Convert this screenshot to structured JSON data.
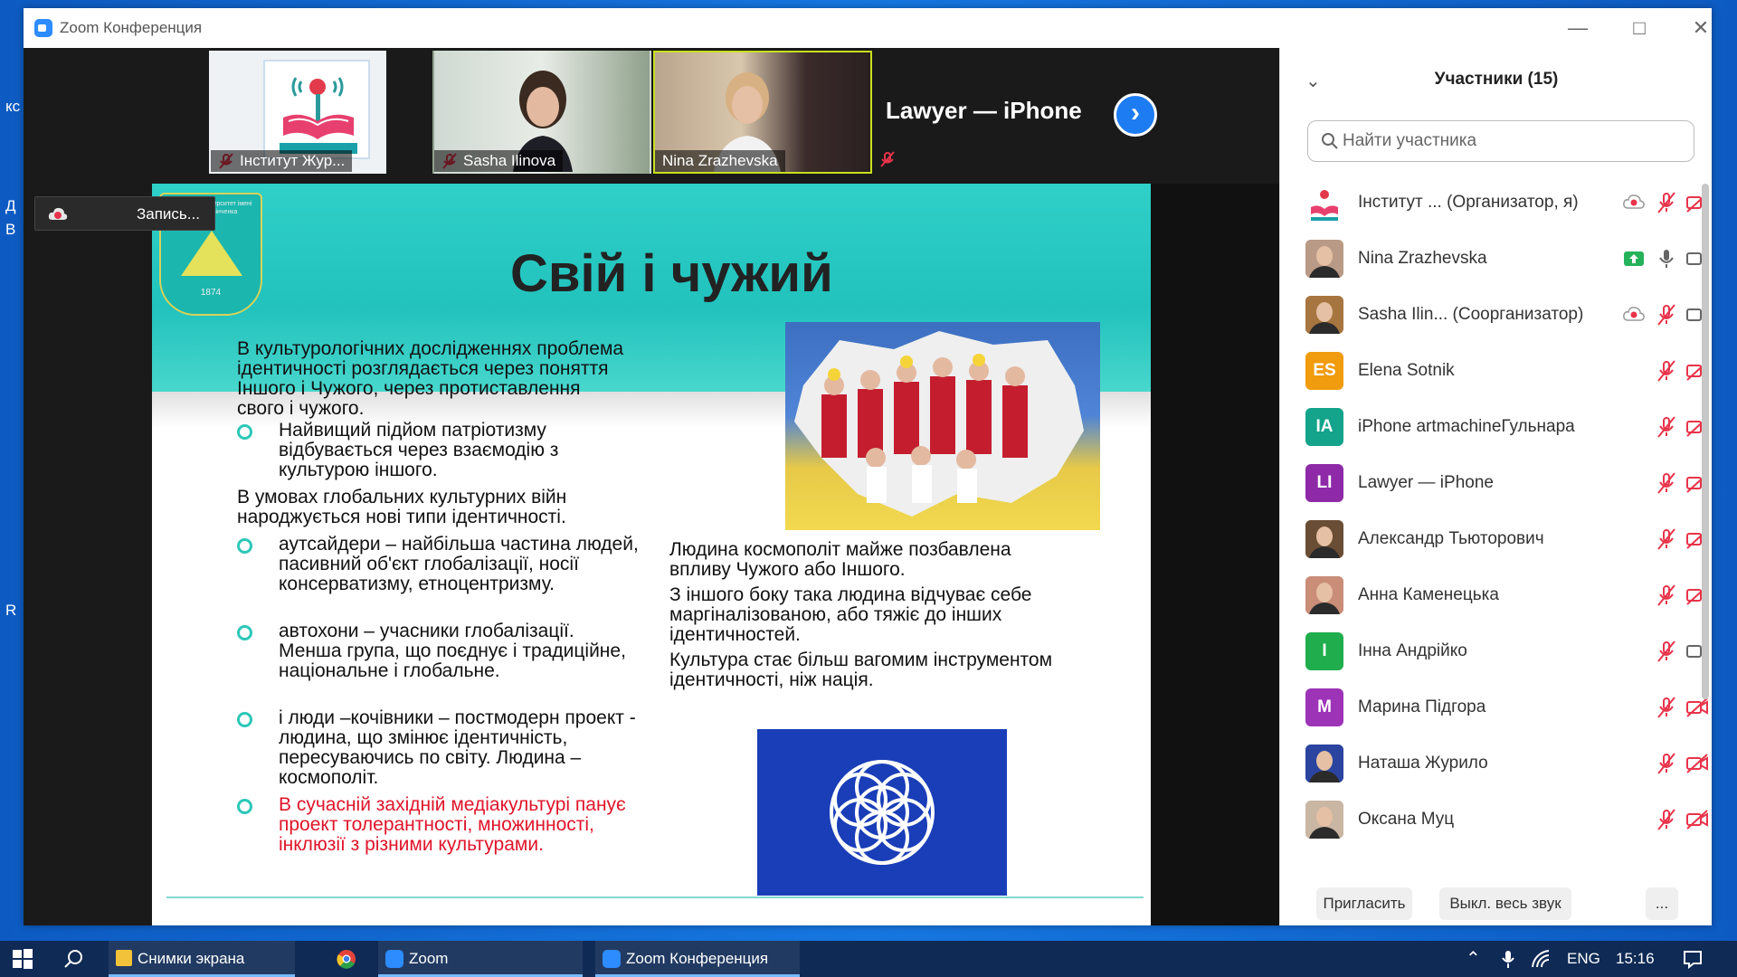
{
  "window": {
    "title": "Zoom Конференция"
  },
  "desktop_labels": [
    "кс",
    "Д",
    "В",
    "R"
  ],
  "thumbnails": [
    {
      "name": "Інститут Жур..."
    },
    {
      "name": "Sasha Ilinova"
    },
    {
      "name": "Nina Zrazhevska"
    }
  ],
  "big_name": "Lawyer — iPhone",
  "recording": {
    "label": "Запись..."
  },
  "slide": {
    "title": "Свій і чужий",
    "logo_caption": "Київський університет імені Бориса Грінченка",
    "logo_year": "1874",
    "intro": "В культурологічних дослідженнях проблема ідентичності розглядається через поняття Іншого і Чужого, через протиставлення свого і чужого.",
    "bullet1": "Найвищий підйом патріотизму відбувається через взаємодію з культурою іншого.",
    "middle": "В умовах глобальних культурних війн народжується нові типи ідентичності.",
    "bullet2": "аутсайдери – найбільша частина людей, пасивний об'єкт глобалізації, носії консерватизму, етноцентризму.",
    "bullet3": "автохони – учасники глобалізації. Менша група, що поєднує і традиційне, національне і глобальне.",
    "bullet4": "і люди –кочівники – постмодерн проект -  людина, що змінює ідентичність, пересуваючись по світу. Людина – космополіт.",
    "bullet5": "В сучасній західній медіакультурі панує проект толерантності, множинності, інклюзії з різними культурами.",
    "right1": "Людина космополіт майже позбавлена впливу Чужого або Іншого.",
    "right2": "З іншого боку така людина відчуває себе маргіналізованою, або тяжіє до інших ідентичностей.",
    "right3": "Культура стає більш вагомим інструментом ідентичності, ніж нація."
  },
  "panel": {
    "title": "Участники (15)",
    "search_placeholder": "Найти участника",
    "participants": [
      {
        "name": "Інститут ...  (Организатор, я)",
        "initials": "",
        "color": "#ffffff",
        "mic": "muted",
        "video": "off",
        "rec": true
      },
      {
        "name": "Nina Zrazhevska",
        "initials": "",
        "color": "#b99a86",
        "mic": "on",
        "video": "on",
        "share": true
      },
      {
        "name": "Sasha Ilin...  (Соорганизатор)",
        "initials": "",
        "color": "#a7753f",
        "mic": "muted",
        "video": "on",
        "rec": true
      },
      {
        "name": "Elena Sotnik",
        "initials": "ES",
        "color": "#f19b0e",
        "mic": "muted",
        "video": "off"
      },
      {
        "name": "iPhone artmachineГульнара",
        "initials": "IA",
        "color": "#14a38b",
        "mic": "muted",
        "video": "off"
      },
      {
        "name": "Lawyer — iPhone",
        "initials": "LI",
        "color": "#8e2aa8",
        "mic": "muted",
        "video": "off"
      },
      {
        "name": "Александр Тьюторович",
        "initials": "",
        "color": "#6a4d35",
        "mic": "muted",
        "video": "off"
      },
      {
        "name": "Анна Каменецька",
        "initials": "",
        "color": "#c98d78",
        "mic": "muted",
        "video": "off"
      },
      {
        "name": "Інна Андрійко",
        "initials": "I",
        "color": "#20ad4d",
        "mic": "muted",
        "video": "on"
      },
      {
        "name": "Марина Підгора",
        "initials": "M",
        "color": "#9d34b8",
        "mic": "muted",
        "video": "off"
      },
      {
        "name": "Наташа Журило",
        "initials": "",
        "color": "#2a44a0",
        "mic": "muted",
        "video": "off"
      },
      {
        "name": "Оксана Муц",
        "initials": "",
        "color": "#c9b6a3",
        "mic": "muted",
        "video": "off"
      }
    ],
    "buttons": {
      "invite": "Пригласить",
      "mute_all": "Выкл. весь звук",
      "more": "..."
    }
  },
  "taskbar": {
    "items": [
      "Снимки экрана",
      "Zoom",
      "Zoom Конференция"
    ],
    "lang": "ENG",
    "time": "15:16"
  },
  "colors": {
    "accent": "#2d8cff",
    "muted_red": "#e8334a",
    "slide_teal": "#22c2bd"
  }
}
